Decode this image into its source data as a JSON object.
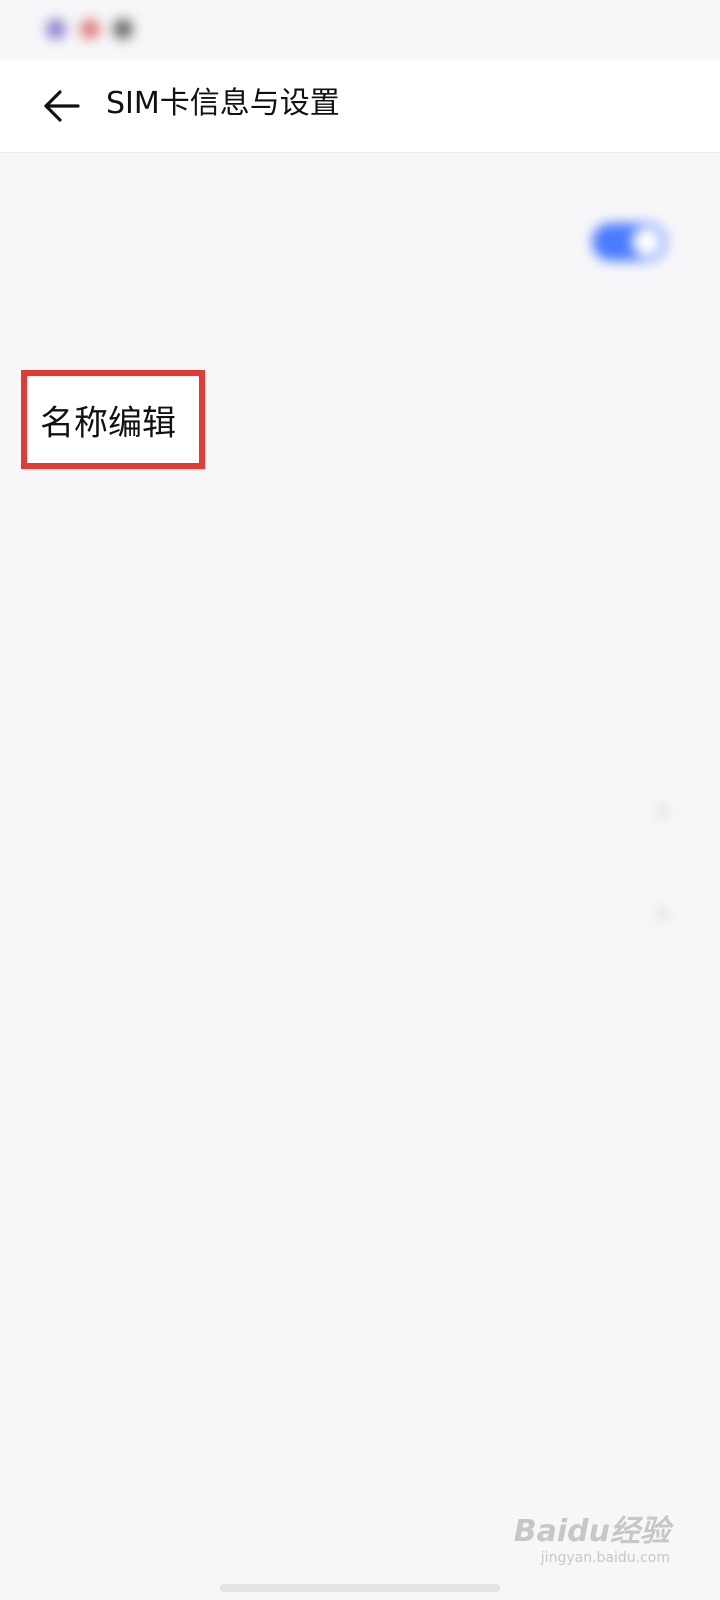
{
  "status_bar": {
    "time": "",
    "right": ""
  },
  "header": {
    "back_icon": "arrow-left-icon",
    "title": "SIM卡信息与设置"
  },
  "settings": {
    "enable_sim": {
      "label": "",
      "toggle_on": true,
      "toggle_color": "#4a7bff"
    },
    "sim_section_header": "",
    "name_edit": {
      "label": "名称编辑",
      "value": ""
    },
    "sim_number": {
      "label": "",
      "value": ""
    },
    "network_section_header": "",
    "data_roaming": {
      "label": "",
      "value": ""
    },
    "operator": {
      "label": "",
      "value": ""
    },
    "apn": {
      "label": ""
    }
  },
  "highlight_color": "#e53935",
  "watermark": {
    "logo": "Baidu经验",
    "sub": "jingyan.baidu.com"
  }
}
